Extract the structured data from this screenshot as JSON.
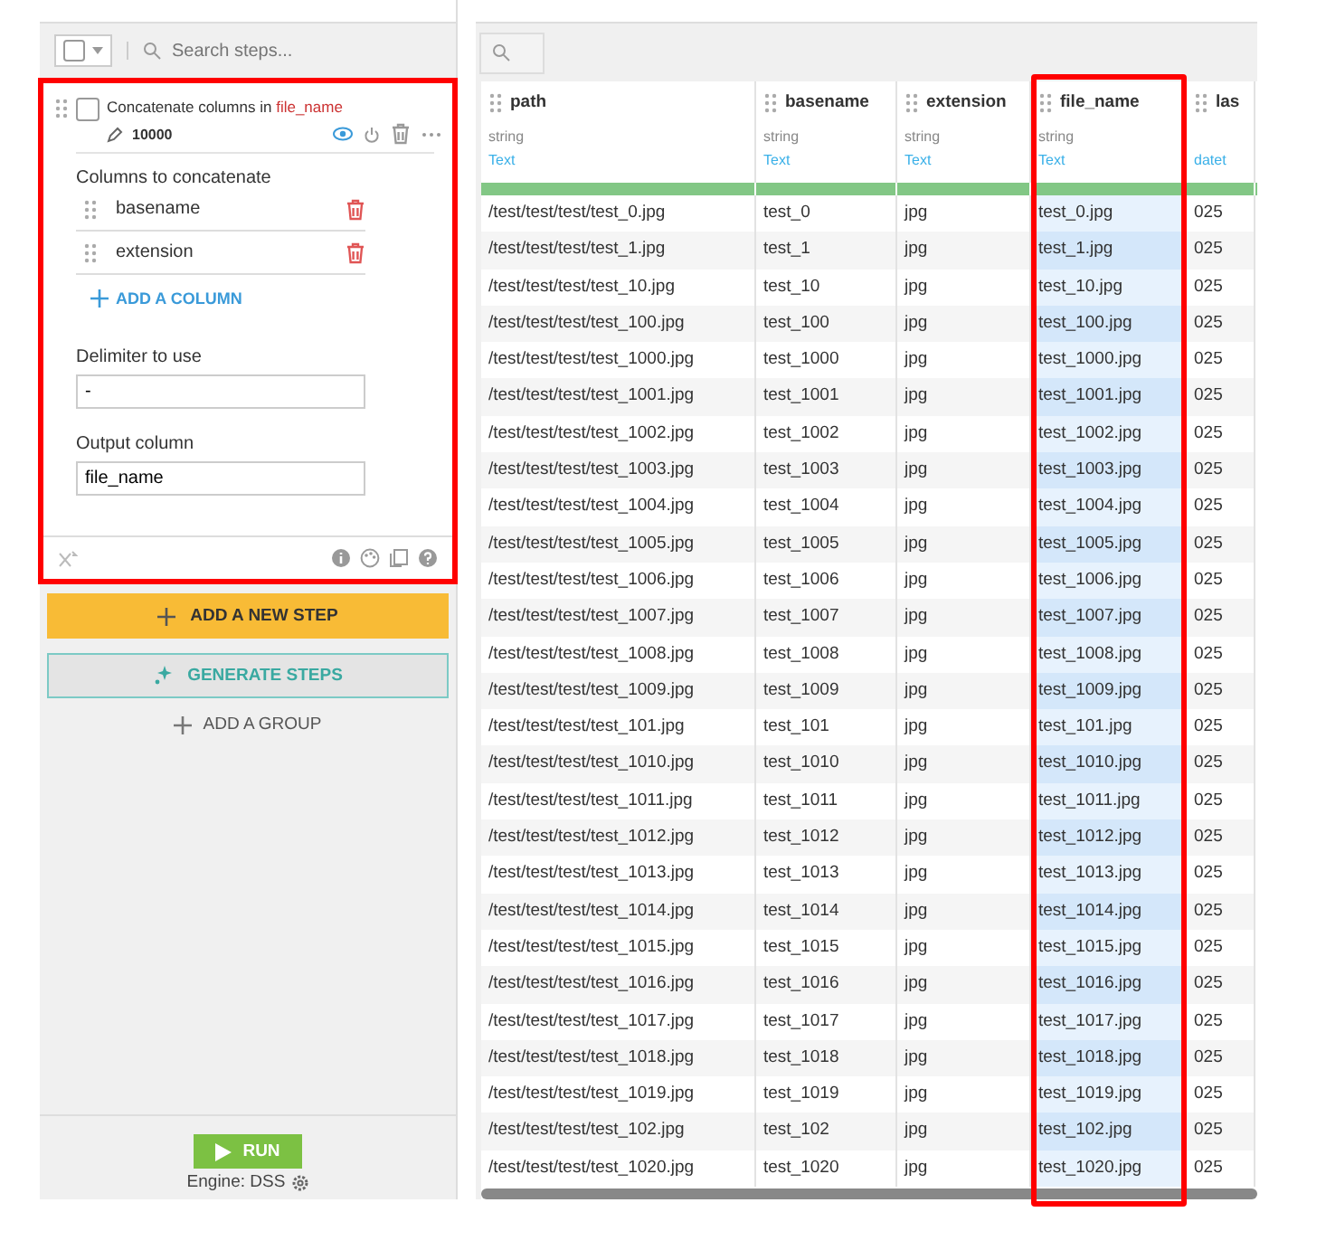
{
  "steps_toolbar": {
    "search_placeholder": "Search steps..."
  },
  "step": {
    "highlighted": true,
    "title": "Concatenate columns in",
    "target": "file_name",
    "sample": "10000",
    "visible": true,
    "columns_label": "Columns to concatenate",
    "columns": [
      "basename",
      "extension"
    ],
    "add_column": "ADD A COLUMN",
    "delimiter_label": "Delimiter to use",
    "delimiter": "-",
    "output_label": "Output column",
    "output": "file_name"
  },
  "add_step": "ADD A NEW STEP",
  "generate_steps": "GENERATE STEPS",
  "add_group": "ADD A GROUP",
  "run": "RUN",
  "engine": "Engine: DSS",
  "table": {
    "columns": [
      {
        "name": "path",
        "type": "string",
        "meaning": "Text",
        "highlighted": false
      },
      {
        "name": "basename",
        "type": "string",
        "meaning": "Text",
        "highlighted": false
      },
      {
        "name": "extension",
        "type": "string",
        "meaning": "Text",
        "highlighted": false
      },
      {
        "name": "file_name",
        "type": "string",
        "meaning": "Text",
        "highlighted": true
      },
      {
        "name": "las",
        "meaning": "datet",
        "highlighted": false
      }
    ],
    "rows": [
      [
        "/test/test/test/test_0.jpg",
        "test_0",
        "jpg",
        "test_0.jpg",
        "025"
      ],
      [
        "/test/test/test/test_1.jpg",
        "test_1",
        "jpg",
        "test_1.jpg",
        "025"
      ],
      [
        "/test/test/test/test_10.jpg",
        "test_10",
        "jpg",
        "test_10.jpg",
        "025"
      ],
      [
        "/test/test/test/test_100.jpg",
        "test_100",
        "jpg",
        "test_100.jpg",
        "025"
      ],
      [
        "/test/test/test/test_1000.jpg",
        "test_1000",
        "jpg",
        "test_1000.jpg",
        "025"
      ],
      [
        "/test/test/test/test_1001.jpg",
        "test_1001",
        "jpg",
        "test_1001.jpg",
        "025"
      ],
      [
        "/test/test/test/test_1002.jpg",
        "test_1002",
        "jpg",
        "test_1002.jpg",
        "025"
      ],
      [
        "/test/test/test/test_1003.jpg",
        "test_1003",
        "jpg",
        "test_1003.jpg",
        "025"
      ],
      [
        "/test/test/test/test_1004.jpg",
        "test_1004",
        "jpg",
        "test_1004.jpg",
        "025"
      ],
      [
        "/test/test/test/test_1005.jpg",
        "test_1005",
        "jpg",
        "test_1005.jpg",
        "025"
      ],
      [
        "/test/test/test/test_1006.jpg",
        "test_1006",
        "jpg",
        "test_1006.jpg",
        "025"
      ],
      [
        "/test/test/test/test_1007.jpg",
        "test_1007",
        "jpg",
        "test_1007.jpg",
        "025"
      ],
      [
        "/test/test/test/test_1008.jpg",
        "test_1008",
        "jpg",
        "test_1008.jpg",
        "025"
      ],
      [
        "/test/test/test/test_1009.jpg",
        "test_1009",
        "jpg",
        "test_1009.jpg",
        "025"
      ],
      [
        "/test/test/test/test_101.jpg",
        "test_101",
        "jpg",
        "test_101.jpg",
        "025"
      ],
      [
        "/test/test/test/test_1010.jpg",
        "test_1010",
        "jpg",
        "test_1010.jpg",
        "025"
      ],
      [
        "/test/test/test/test_1011.jpg",
        "test_1011",
        "jpg",
        "test_1011.jpg",
        "025"
      ],
      [
        "/test/test/test/test_1012.jpg",
        "test_1012",
        "jpg",
        "test_1012.jpg",
        "025"
      ],
      [
        "/test/test/test/test_1013.jpg",
        "test_1013",
        "jpg",
        "test_1013.jpg",
        "025"
      ],
      [
        "/test/test/test/test_1014.jpg",
        "test_1014",
        "jpg",
        "test_1014.jpg",
        "025"
      ],
      [
        "/test/test/test/test_1015.jpg",
        "test_1015",
        "jpg",
        "test_1015.jpg",
        "025"
      ],
      [
        "/test/test/test/test_1016.jpg",
        "test_1016",
        "jpg",
        "test_1016.jpg",
        "025"
      ],
      [
        "/test/test/test/test_1017.jpg",
        "test_1017",
        "jpg",
        "test_1017.jpg",
        "025"
      ],
      [
        "/test/test/test/test_1018.jpg",
        "test_1018",
        "jpg",
        "test_1018.jpg",
        "025"
      ],
      [
        "/test/test/test/test_1019.jpg",
        "test_1019",
        "jpg",
        "test_1019.jpg",
        "025"
      ],
      [
        "/test/test/test/test_102.jpg",
        "test_102",
        "jpg",
        "test_102.jpg",
        "025"
      ],
      [
        "/test/test/test/test_1020.jpg",
        "test_1020",
        "jpg",
        "test_1020.jpg",
        "025"
      ]
    ]
  }
}
